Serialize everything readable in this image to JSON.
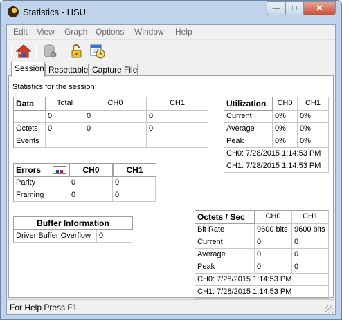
{
  "window": {
    "title": "Statistics - HSU",
    "minimize": "—",
    "maximize": "□",
    "close": "✕"
  },
  "menu": [
    "Edit",
    "View",
    "Graph",
    "Options",
    "Window",
    "Help"
  ],
  "toolbar": {
    "buttons": [
      {
        "icon": "home-icon"
      },
      {
        "icon": "database-icon"
      },
      {
        "icon": "unlock-icon"
      },
      {
        "icon": "calendar-clock-icon"
      }
    ]
  },
  "tabs": [
    {
      "label": "Session",
      "active": true
    },
    {
      "label": "Resettable",
      "active": false
    },
    {
      "label": "Capture File",
      "active": false
    }
  ],
  "session": {
    "heading": "Statistics for the session",
    "data_table": {
      "title": "Data",
      "columns": [
        "Total",
        "CH0",
        "CH1"
      ],
      "rows": [
        {
          "label": "",
          "values": [
            "0",
            "0",
            "0"
          ]
        },
        {
          "label": "Octets",
          "values": [
            "0",
            "0",
            "0"
          ]
        },
        {
          "label": "Events",
          "values": [
            "",
            "",
            ""
          ]
        }
      ]
    },
    "errors_table": {
      "title": "Errors",
      "columns": [
        "CH0",
        "CH1"
      ],
      "rows": [
        {
          "label": "Parity",
          "values": [
            "0",
            "0"
          ]
        },
        {
          "label": "Framing",
          "values": [
            "0",
            "0"
          ]
        }
      ]
    },
    "buffer": {
      "title": "Buffer Information",
      "label": "Driver Buffer Overflow",
      "value": "0"
    },
    "utilization": {
      "title": "Utilization",
      "columns": [
        "CH0",
        "CH1"
      ],
      "rows": [
        {
          "label": "Current",
          "values": [
            "0%",
            "0%"
          ]
        },
        {
          "label": "Average",
          "values": [
            "0%",
            "0%"
          ]
        },
        {
          "label": "Peak",
          "values": [
            "0%",
            "0%"
          ]
        }
      ],
      "timestamps": [
        "CH0: 7/28/2015 1:14:53 PM",
        "CH1: 7/28/2015 1:14:53 PM"
      ]
    },
    "octets_sec": {
      "title": "Octets / Sec",
      "columns": [
        "CH0",
        "CH1"
      ],
      "rows": [
        {
          "label": "Bit Rate",
          "values": [
            "9600 bits",
            "9600 bits"
          ]
        },
        {
          "label": "Current",
          "values": [
            "0",
            "0"
          ]
        },
        {
          "label": "Average",
          "values": [
            "0",
            "0"
          ]
        },
        {
          "label": "Peak",
          "values": [
            "0",
            "0"
          ]
        }
      ],
      "timestamps": [
        "CH0: 7/28/2015 1:14:53 PM",
        "CH1: 7/28/2015 1:14:53 PM"
      ]
    }
  },
  "status": {
    "text": "For Help Press F1"
  },
  "colors": {
    "title_bar": "#bfd3ea",
    "close_button": "#c9513a",
    "panel": "#ffffff"
  }
}
